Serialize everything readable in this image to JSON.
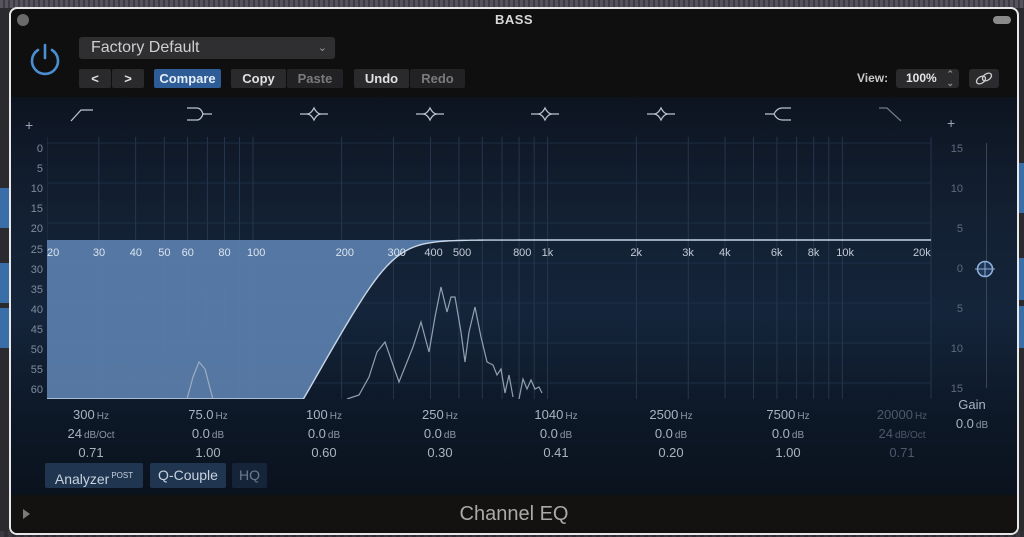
{
  "window": {
    "title": "BASS",
    "footer_title": "Channel EQ"
  },
  "header": {
    "preset": "Factory Default",
    "prev_label": "<",
    "next_label": ">",
    "compare_label": "Compare",
    "copy_label": "Copy",
    "paste_label": "Paste",
    "undo_label": "Undo",
    "redo_label": "Redo",
    "view_label": "View:",
    "view_value": "100%"
  },
  "eq": {
    "left_scale": [
      "0",
      "5",
      "10",
      "15",
      "20",
      "25",
      "30",
      "35",
      "40",
      "45",
      "50",
      "55",
      "60"
    ],
    "right_scale": [
      "15",
      "10",
      "5",
      "0",
      "5",
      "10",
      "15"
    ],
    "freq_labels": [
      "20",
      "30",
      "40",
      "50",
      "60",
      "80",
      "100",
      "200",
      "300",
      "400",
      "500",
      "800",
      "1k",
      "2k",
      "3k",
      "4k",
      "6k",
      "8k",
      "10k",
      "20k"
    ],
    "band_types": [
      "low-cut",
      "low-shelf",
      "peak",
      "peak",
      "peak",
      "peak",
      "high-shelf",
      "high-cut"
    ],
    "analyzer_colors": {
      "filled_region": "#5b7fac",
      "curve": "#c9d6e6",
      "spectrum": "#aab6c6"
    }
  },
  "bands": [
    {
      "freq": "300",
      "freq_unit": "Hz",
      "gain": "24",
      "gain_unit": "dB/Oct",
      "q": "0.71",
      "enabled": true
    },
    {
      "freq": "75.0",
      "freq_unit": "Hz",
      "gain": "0.0",
      "gain_unit": "dB",
      "q": "1.00",
      "enabled": true
    },
    {
      "freq": "100",
      "freq_unit": "Hz",
      "gain": "0.0",
      "gain_unit": "dB",
      "q": "0.60",
      "enabled": true
    },
    {
      "freq": "250",
      "freq_unit": "Hz",
      "gain": "0.0",
      "gain_unit": "dB",
      "q": "0.30",
      "enabled": true
    },
    {
      "freq": "1040",
      "freq_unit": "Hz",
      "gain": "0.0",
      "gain_unit": "dB",
      "q": "0.41",
      "enabled": true
    },
    {
      "freq": "2500",
      "freq_unit": "Hz",
      "gain": "0.0",
      "gain_unit": "dB",
      "q": "0.20",
      "enabled": true
    },
    {
      "freq": "7500",
      "freq_unit": "Hz",
      "gain": "0.0",
      "gain_unit": "dB",
      "q": "1.00",
      "enabled": true
    },
    {
      "freq": "20000",
      "freq_unit": "Hz",
      "gain": "24",
      "gain_unit": "dB/Oct",
      "q": "0.71",
      "enabled": false
    }
  ],
  "gain": {
    "label": "Gain",
    "value": "0.0",
    "unit": "dB"
  },
  "options": {
    "analyzer_label": "Analyzer",
    "analyzer_mode": "POST",
    "qcouple_label": "Q-Couple",
    "hq_label": "HQ"
  }
}
